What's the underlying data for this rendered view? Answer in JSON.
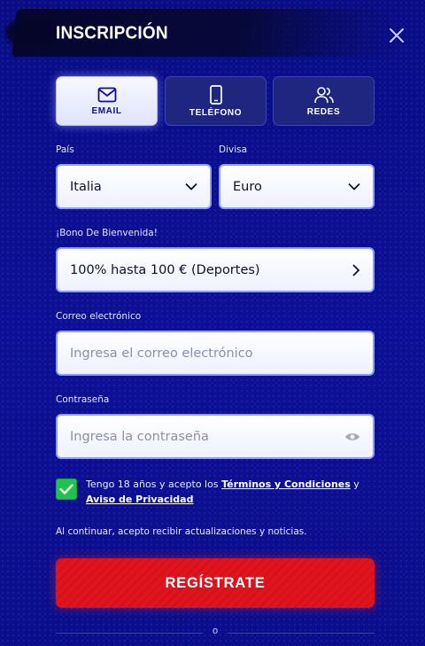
{
  "header": {
    "title": "INSCRIPCIÓN",
    "close_icon": "close-icon"
  },
  "tabs": [
    {
      "label": "EMAIL",
      "icon": "envelope-icon",
      "active": true
    },
    {
      "label": "TELÉFONO",
      "icon": "phone-icon",
      "active": false
    },
    {
      "label": "REDES",
      "icon": "users-icon",
      "active": false
    }
  ],
  "form": {
    "country": {
      "label": "País",
      "value": "Italia"
    },
    "currency": {
      "label": "Divisa",
      "value": "Euro"
    },
    "bonus": {
      "label": "¡Bono De Bienvenida!",
      "value": "100% hasta 100 € (Deportes)"
    },
    "email": {
      "label": "Correo electrónico",
      "placeholder": "Ingresa el correo electrónico"
    },
    "password": {
      "label": "Contraseña",
      "placeholder": "Ingresa la contraseña"
    }
  },
  "consent": {
    "checked": true,
    "text_prefix": "Tengo 18 años y acepto los ",
    "terms_link": "Términos y Condiciones",
    "text_middle": " y",
    "privacy_link": "Aviso de Privacidad"
  },
  "notice": "Al continuar, acepto recibir actualizaciones y noticias.",
  "submit_label": "REGÍSTRATE",
  "divider_text": "o",
  "colors": {
    "background": "#0b0f8f",
    "accent_red": "#e0141d",
    "check_green": "#1fc34a",
    "field_border": "#8e9cff"
  }
}
